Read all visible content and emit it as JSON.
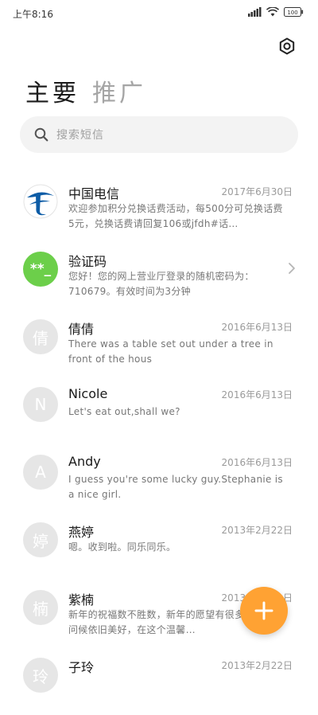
{
  "status_bar": {
    "time": "上午8:16",
    "battery": "100"
  },
  "header": {
    "settings_icon": "settings-hexagon-icon",
    "tabs": [
      {
        "label": "主要",
        "active": true
      },
      {
        "label": "推广",
        "active": false
      }
    ]
  },
  "search": {
    "placeholder": "搜索短信"
  },
  "conversations": [
    {
      "name": "中国电信",
      "date": "2017年6月30日",
      "preview": "欢迎参加积分兑换话费活动，每500分可兑换话费5元，兑换话费请回复106或jfdh#话…",
      "avatar_type": "logo",
      "avatar_text": ""
    },
    {
      "name": "验证码",
      "date": "",
      "preview": "您好！您的网上营业厅登录的随机密码为：710679。有效时间为3分钟",
      "avatar_type": "green",
      "avatar_text": "**_"
    },
    {
      "name": "倩倩",
      "date": "2016年6月13日",
      "preview": "There was a table set out under a tree in front of the hous",
      "avatar_type": "gray",
      "avatar_text": "倩"
    },
    {
      "name": "Nicole",
      "date": "2016年6月13日",
      "preview": "Let's eat out,shall we?",
      "avatar_type": "gray",
      "avatar_text": "N"
    },
    {
      "name": "Andy",
      "date": "2016年6月13日",
      "preview": "I guess you're some lucky guy.Stephanie is a nice girl.",
      "avatar_type": "gray",
      "avatar_text": "A"
    },
    {
      "name": "燕婷",
      "date": "2013年2月22日",
      "preview": "嗯。收到啦。同乐同乐。",
      "avatar_type": "gray",
      "avatar_text": "婷"
    },
    {
      "name": "紫楠",
      "date": "2013年2月22日",
      "preview": "新年的祝福数不胜数，新年的愿望有很多，新年的问候依旧美好，在这个温馨…",
      "avatar_type": "gray",
      "avatar_text": "楠"
    },
    {
      "name": "子玲",
      "date": "2013年2月22日",
      "preview": "",
      "avatar_type": "gray",
      "avatar_text": "玲"
    }
  ],
  "fab": {
    "icon": "plus-icon"
  },
  "colors": {
    "accent": "#ffa233",
    "verification_avatar": "#6ccf4a",
    "search_bg": "#f3f3f3",
    "default_avatar": "#e6e6e6",
    "telecom_blue": "#0d5ca6"
  }
}
